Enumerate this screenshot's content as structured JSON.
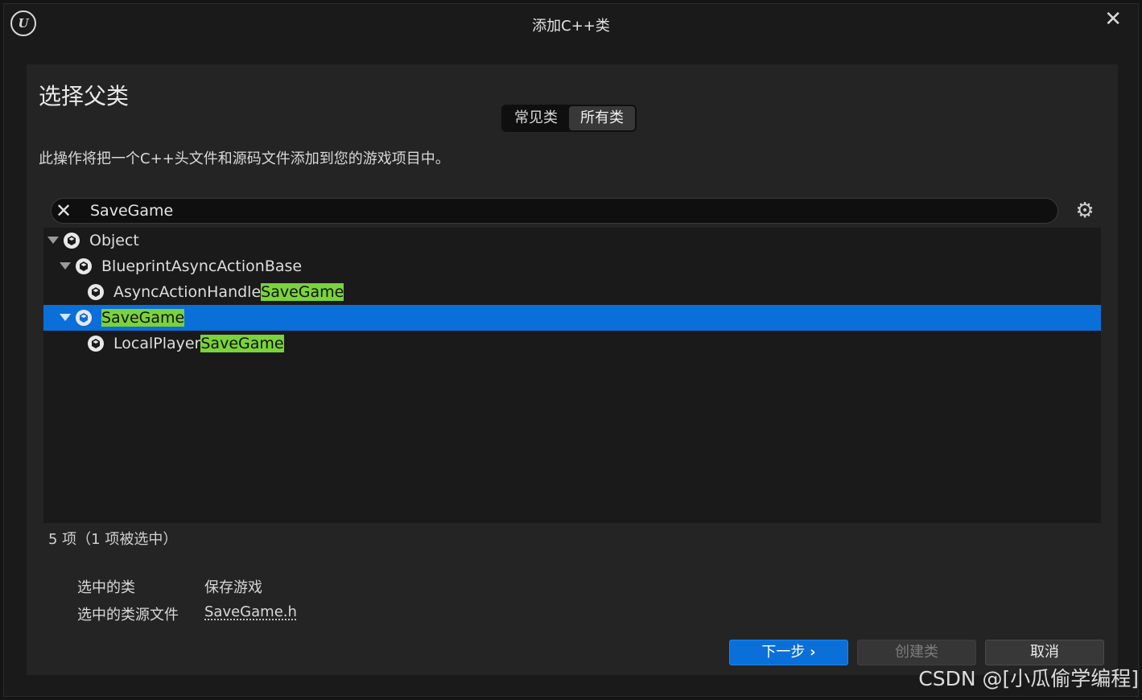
{
  "window": {
    "title": "添加C++类",
    "logo_text": "U"
  },
  "header": {
    "heading": "选择父类",
    "description": "此操作将把一个C++头文件和源码文件添加到您的游戏项目中。"
  },
  "tabs": [
    {
      "label": "常见类",
      "active": false
    },
    {
      "label": "所有类",
      "active": true
    }
  ],
  "search": {
    "value": "SaveGame",
    "placeholder": ""
  },
  "tree": [
    {
      "pre": "Object",
      "match": "",
      "post": "",
      "expanded": true,
      "selected": false
    },
    {
      "pre": "BlueprintAsyncActionBase",
      "match": "",
      "post": "",
      "expanded": true,
      "selected": false
    },
    {
      "pre": "AsyncActionHandle",
      "match": "SaveGame",
      "post": "",
      "expanded": false,
      "selected": false
    },
    {
      "pre": "",
      "match": "SaveGame",
      "post": "",
      "expanded": true,
      "selected": true
    },
    {
      "pre": "LocalPlayer",
      "match": "SaveGame",
      "post": "",
      "expanded": false,
      "selected": false
    }
  ],
  "status": {
    "count_text": "5 项（1 项被选中）"
  },
  "selected_info": {
    "class_label": "选中的类",
    "class_value": "保存游戏",
    "file_label": "选中的类源文件",
    "file_value": "SaveGame.h"
  },
  "buttons": {
    "next": "下一步",
    "next_icon": "›",
    "create": "创建类",
    "cancel": "取消"
  },
  "watermark": "CSDN @[小瓜偷学编程]",
  "colors": {
    "accent": "#0a6fd8",
    "highlight": "#7ad33a",
    "background": "#1a1a1a"
  }
}
